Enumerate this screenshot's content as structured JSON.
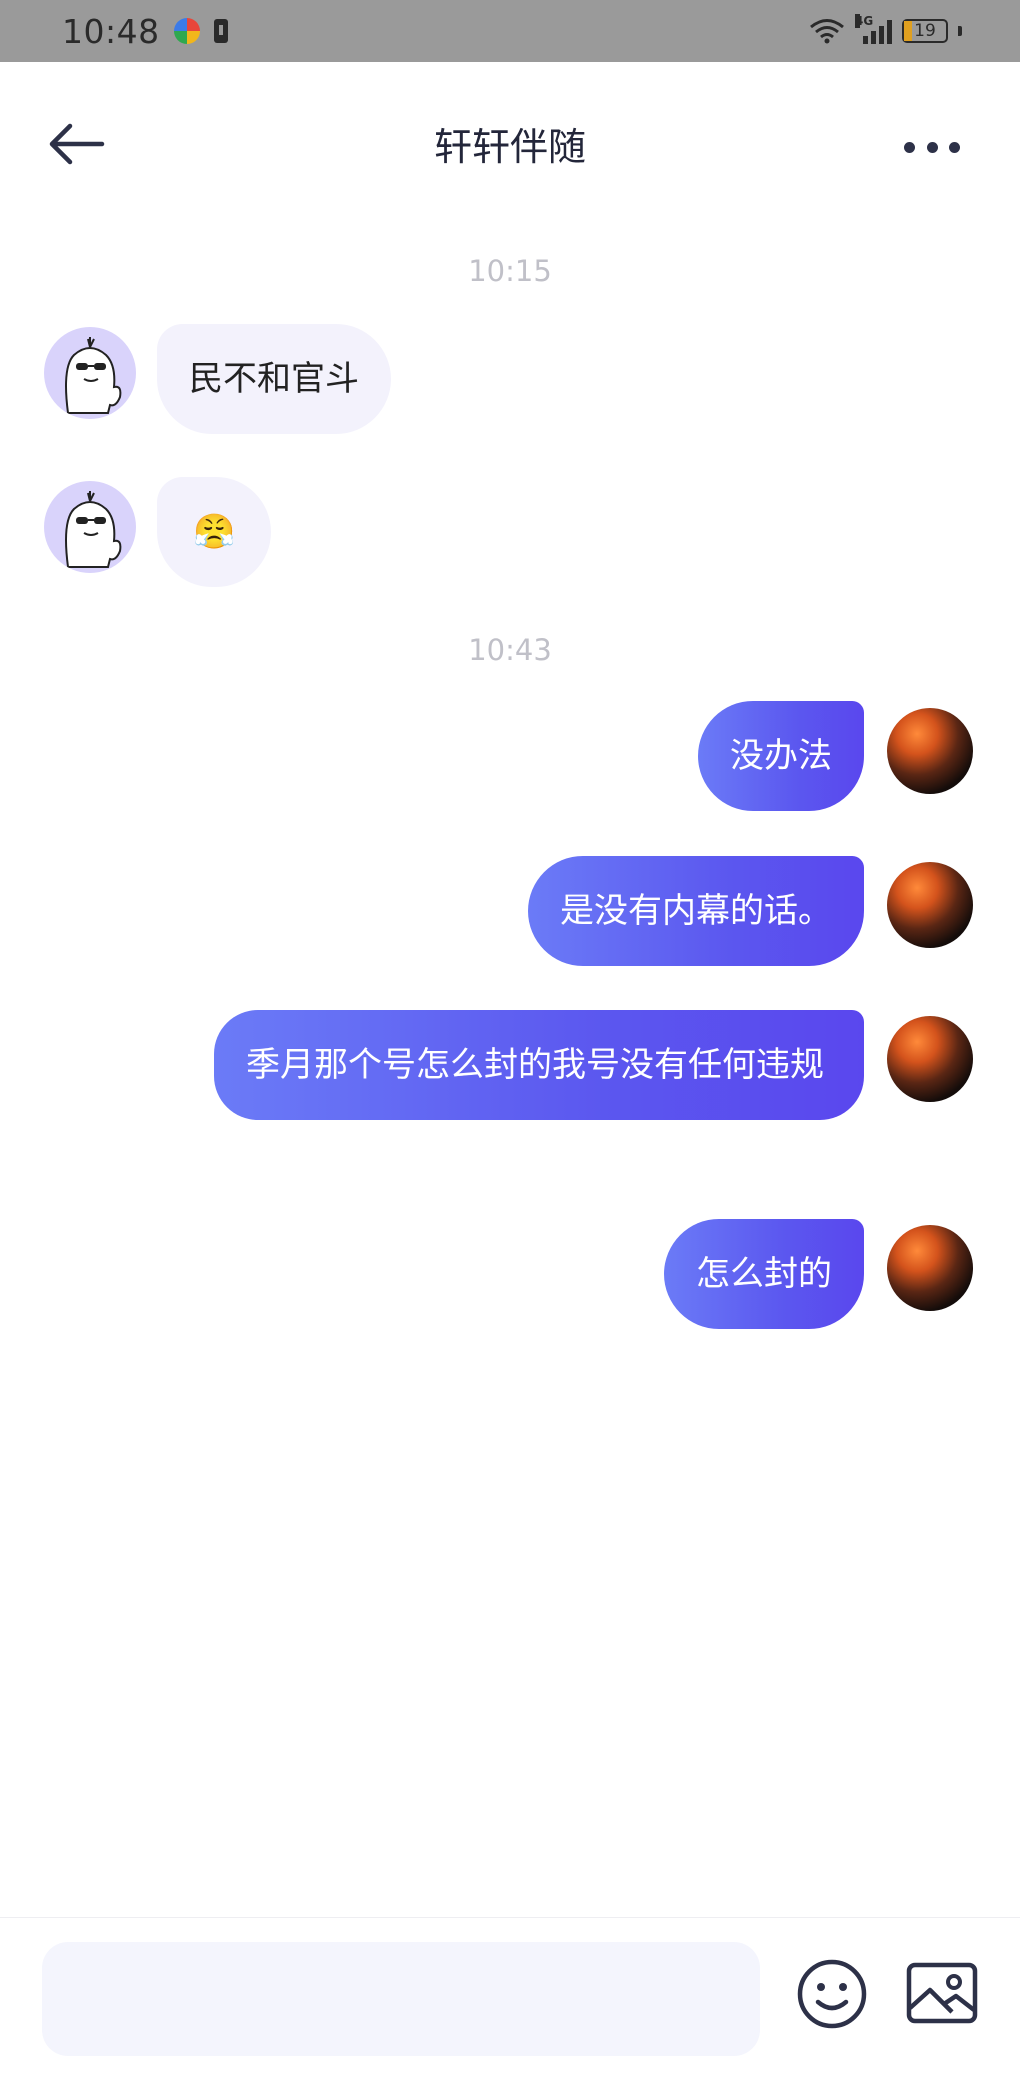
{
  "status_bar": {
    "time": "10:48",
    "network": "4G",
    "battery": "19"
  },
  "header": {
    "title": "轩轩伴随"
  },
  "messages": {
    "time1": "10:15",
    "bot_msg_1": "民不和官斗",
    "bot_msg_2": "😤",
    "time2": "10:43",
    "my_msg_1": "没办法",
    "my_msg_2": "是没有内幕的话。",
    "my_msg_3": "季月那个号怎么封的我号没有任何违规",
    "my_msg_4": "怎么封的"
  },
  "input": {
    "placeholder": ""
  },
  "colors": {
    "accent_start": "#6b7bf7",
    "accent_end": "#5a47ee",
    "incoming_bubble": "#f3f2fc",
    "input_bg": "#f4f5fd"
  },
  "icons": [
    "back-arrow-icon",
    "more-dots-icon",
    "emoji-icon",
    "image-icon"
  ]
}
